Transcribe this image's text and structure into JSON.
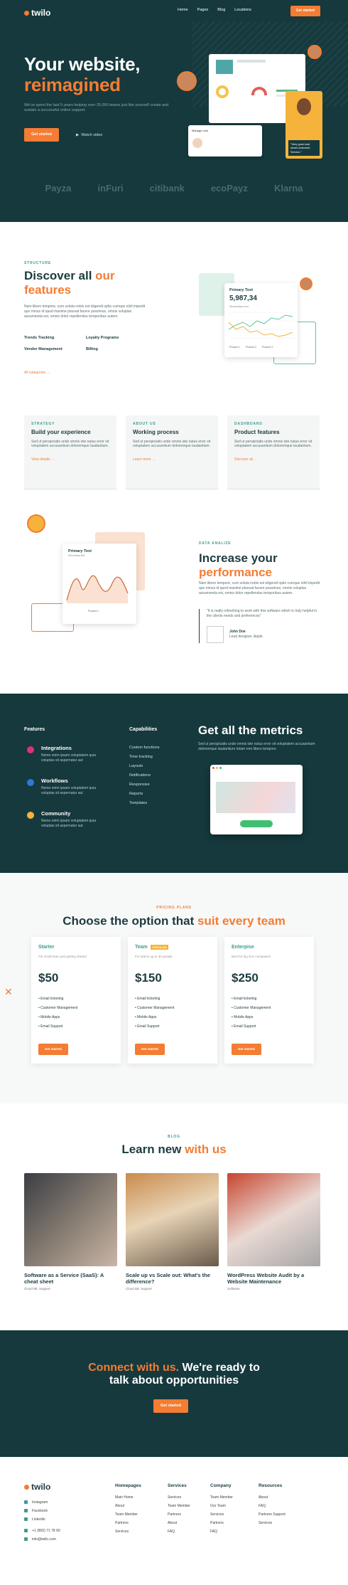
{
  "nav": {
    "brand": "twilo",
    "links": [
      "Home",
      "Pages",
      "Blog",
      "Locations"
    ],
    "cta": "Get started"
  },
  "hero": {
    "title_line1": "Your website,",
    "title_line2": "reimagined",
    "subtitle": "We've spent the last 5 years helping over 25,000 teams just like yourself create and sustain a successful online support.",
    "cta": "Get started",
    "watch": "Watch video",
    "mock_card_title": "Manage cost",
    "photo_caption": "\"Very good and smart customer. Service.\"",
    "logos": [
      "Payza",
      "inFuri",
      "citibank",
      "ecoPayz",
      "Klarna"
    ]
  },
  "structure": {
    "eyebrow": "STRUCTURE",
    "title_a": "Discover all ",
    "title_b": "our",
    "title_c": "features",
    "text": "Nam libero tempore, cum soluta nobis est eligendi optio cumque nihil impedit quo minus id quod maxime placeat facere possimus, omnis voluptas assumenda est, omnis dolor repellendus temporibus autem.",
    "features": [
      "Trends Tracking",
      "Loyalty Programs",
      "Vendor Management",
      "Billing"
    ],
    "link": "All categories  →",
    "card_title": "Primary Text",
    "card_value": "5,987,34",
    "card_sub": "Secondary text",
    "legend": [
      "Product 1",
      "Product 2",
      "Product 3"
    ]
  },
  "cards": [
    {
      "eyebrow": "STRATEGY",
      "title": "Build your experience",
      "text": "Sed ut perspiciatis unde omnis iste natus error sit voluptatem accusantium doloremque laudantium.",
      "link": "View details  →"
    },
    {
      "eyebrow": "ABOUT US",
      "title": "Working process",
      "text": "Sed ut perspiciatis unde omnis iste natus error sit voluptatem accusantium doloremque laudantium.",
      "link": "Learn more  →"
    },
    {
      "eyebrow": "DASHBOARD",
      "title": "Product features",
      "text": "Sed ut perspiciatis unde omnis iste natus error sit voluptatem accusantium doloremque laudantium.",
      "link": "Discover all  →"
    }
  ],
  "analize": {
    "eyebrow": "DATA ANALIZE",
    "title_a": "Increase your",
    "title_b": "performance",
    "text": "Nam libero tempore, cum soluta nobis est eligendi optio cumque nihil impedit quo minus id quod maxime placeat facere possimus, omnis voluptas assumenda est, omnis dolor repellendus temporibus autem.",
    "quote": "\"It is really refreshing to work with this software which is truly helpful in the clients needs and preferences\"",
    "author": "John Doe",
    "author_role": "Lead designer, Apple",
    "card_title": "Primary Text",
    "card_sub": "Secondary text",
    "card_legend": "Product 1"
  },
  "metrics": {
    "features_h": "Features",
    "capabilities_h": "Capabilities",
    "items": [
      {
        "title": "Integrations",
        "text": "Nemo enim ipsam voluptatem quia voluptas sit aspernatur aut"
      },
      {
        "title": "Workflows",
        "text": "Nemo enim ipsam voluptatem quia voluptas sit aspernatur aut"
      },
      {
        "title": "Community",
        "text": "Nemo enim ipsam voluptatem quia voluptas sit aspernatur aut"
      }
    ],
    "caps": [
      "Custom functions",
      "Time tracking",
      "Layouts",
      "Notifications",
      "Responsive",
      "Reports",
      "Templates"
    ],
    "title": "Get all the metrics",
    "text": "Sed ut perspiciatis unde omnis iste natus error sit voluptatem accusantium doloremque laudantium totam rem libero tempore."
  },
  "pricing": {
    "eyebrow": "PRICING PLANS",
    "title_a": "Choose the option that ",
    "title_b": "suit every team",
    "plans": [
      {
        "name": "Starter",
        "badge": "",
        "sub": "For small team just getting started",
        "price": "$50",
        "items": [
          "Email ticketing",
          "Customer Management",
          "Mobile Apps",
          "Email Support"
        ],
        "cta": "Get started"
      },
      {
        "name": "Team",
        "badge": "POPULAR",
        "sub": "For teams up to 30 people",
        "price": "$150",
        "items": [
          "Email ticketing",
          "Customer Management",
          "Mobile Apps",
          "Email Support"
        ],
        "cta": "Get started"
      },
      {
        "name": "Enterpise",
        "badge": "",
        "sub": "Best for big size companies",
        "price": "$250",
        "items": [
          "Email ticketing",
          "Customer Management",
          "Mobile Apps",
          "Email Support"
        ],
        "cta": "Get started"
      }
    ]
  },
  "blog": {
    "eyebrow": "BLOG",
    "title_a": "Learn new ",
    "title_b": "with us",
    "posts": [
      {
        "title": "Software as a Service (SaaS): A cheat sheet",
        "cat": "Cloud 5B, Support"
      },
      {
        "title": "Scale up vs Scale out: What's the difference?",
        "cat": "Cloud 5B, Support"
      },
      {
        "title": "WordPress Website Audit by a Website Maintenance",
        "cat": "Software"
      }
    ]
  },
  "cta": {
    "line1_a": "Connect with us.",
    "line1_b": " We're ready to",
    "line2": "talk about opportunities",
    "button": "Get started"
  },
  "footer": {
    "brand": "twilo",
    "social": [
      "Instagram",
      "Facebook",
      "Linkedin",
      "+1 (800) 71 78 90",
      "info@twilo.com"
    ],
    "cols": [
      {
        "h": "Homepages",
        "items": [
          "Main Home",
          "About",
          "Team Member",
          "Partners",
          "Services"
        ]
      },
      {
        "h": "Services",
        "items": [
          "Services",
          "Team Member",
          "Partners",
          "About",
          "FAQ"
        ]
      },
      {
        "h": "Company",
        "items": [
          "Team Member",
          "Our Team",
          "Services",
          "Partners",
          "FAQ"
        ]
      },
      {
        "h": "Resources",
        "items": [
          "About",
          "FAQ",
          "Partners Support",
          "Services"
        ]
      }
    ]
  }
}
